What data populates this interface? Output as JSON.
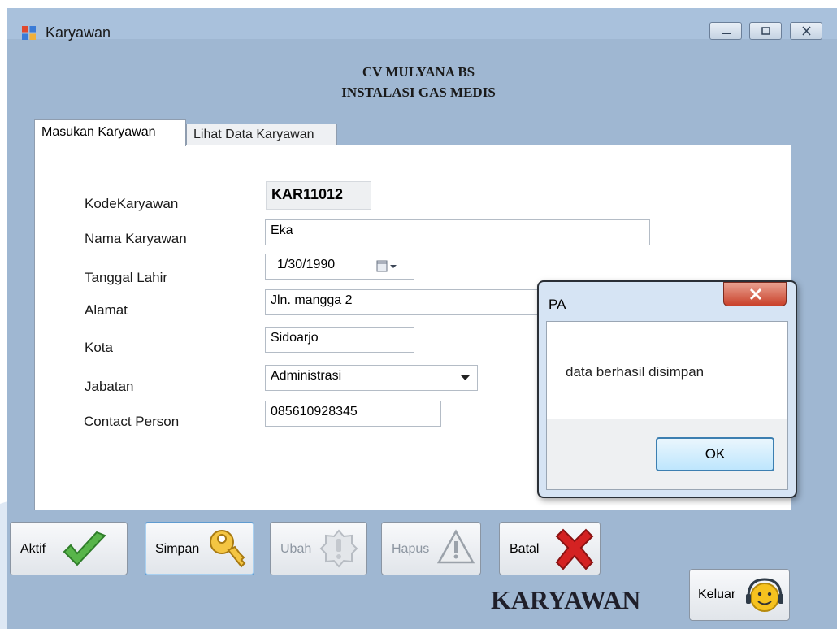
{
  "window": {
    "title": "Karyawan"
  },
  "header": {
    "line1": "CV MULYANA BS",
    "line2": "INSTALASI GAS MEDIS"
  },
  "tabs": [
    {
      "label": "Masukan Karyawan",
      "active": true
    },
    {
      "label": "Lihat Data Karyawan",
      "active": false
    }
  ],
  "form": {
    "kode_label": "KodeKaryawan",
    "kode_value": "KAR11012",
    "nama_label": "Nama Karyawan",
    "nama_value": "Eka",
    "tanggal_label": "Tanggal Lahir",
    "tanggal_value": "1/30/1990",
    "alamat_label": "Alamat",
    "alamat_value": "Jln. mangga 2",
    "kota_label": "Kota",
    "kota_value": "Sidoarjo",
    "jabatan_label": "Jabatan",
    "jabatan_value": "Administrasi",
    "cp_label": "Contact Person",
    "cp_value": "085610928345"
  },
  "buttons": {
    "aktif": "Aktif",
    "simpan": "Simpan",
    "ubah": "Ubah",
    "hapus": "Hapus",
    "batal": "Batal",
    "keluar": "Keluar"
  },
  "footer_title": "KARYAWAN",
  "dialog": {
    "title": "PA",
    "message": "data berhasil disimpan",
    "ok": "OK"
  },
  "icons": {
    "app": "app-form-icon",
    "aktif": "checkmark-icon",
    "simpan": "key-icon",
    "ubah": "alert-badge-icon",
    "hapus": "warning-triangle-icon",
    "batal": "red-x-icon",
    "keluar": "headset-smiley-icon"
  },
  "colors": {
    "background": "#9fb7d2",
    "ok_border": "#3c7fb1",
    "batal_icon": "#d42222",
    "aktif_icon": "#58b54a"
  }
}
